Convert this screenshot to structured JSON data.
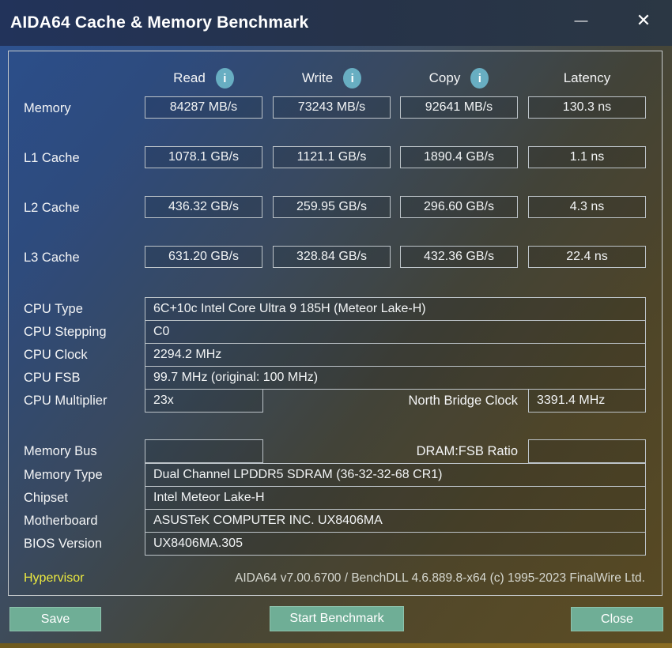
{
  "window": {
    "title": "AIDA64 Cache & Memory Benchmark",
    "minimize_glyph": "—",
    "close_glyph": "✕"
  },
  "benchmark": {
    "columns": [
      {
        "label": "Read",
        "has_info": true
      },
      {
        "label": "Write",
        "has_info": true
      },
      {
        "label": "Copy",
        "has_info": true
      },
      {
        "label": "Latency",
        "has_info": false
      }
    ],
    "info_glyph": "i",
    "rows": [
      {
        "label": "Memory",
        "values": [
          "84287 MB/s",
          "73243 MB/s",
          "92641 MB/s",
          "130.3 ns"
        ]
      },
      {
        "label": "L1 Cache",
        "values": [
          "1078.1 GB/s",
          "1121.1 GB/s",
          "1890.4 GB/s",
          "1.1 ns"
        ]
      },
      {
        "label": "L2 Cache",
        "values": [
          "436.32 GB/s",
          "259.95 GB/s",
          "296.60 GB/s",
          "4.3 ns"
        ]
      },
      {
        "label": "L3 Cache",
        "values": [
          "631.20 GB/s",
          "328.84 GB/s",
          "432.36 GB/s",
          "22.4 ns"
        ]
      }
    ]
  },
  "cpu_info": {
    "rows": [
      {
        "label": "CPU Type",
        "value": "6C+10c Intel Core Ultra 9 185H  (Meteor Lake-H)"
      },
      {
        "label": "CPU Stepping",
        "value": "C0"
      },
      {
        "label": "CPU Clock",
        "value": "2294.2 MHz"
      },
      {
        "label": "CPU FSB",
        "value": "99.7 MHz  (original: 100 MHz)"
      }
    ],
    "multiplier": {
      "label": "CPU Multiplier",
      "value": "23x"
    },
    "north_bridge": {
      "label": "North Bridge Clock",
      "value": "3391.4 MHz"
    }
  },
  "memory_info": {
    "bus": {
      "label": "Memory Bus",
      "value": ""
    },
    "dram_fsb": {
      "label": "DRAM:FSB Ratio",
      "value": ""
    },
    "rows": [
      {
        "label": "Memory Type",
        "value": "Dual Channel LPDDR5 SDRAM  (36-32-32-68 CR1)"
      },
      {
        "label": "Chipset",
        "value": "Intel Meteor Lake-H"
      },
      {
        "label": "Motherboard",
        "value": "ASUSTeK COMPUTER INC. UX8406MA"
      },
      {
        "label": "BIOS Version",
        "value": "UX8406MA.305"
      }
    ]
  },
  "footer": {
    "hypervisor_label": "Hypervisor",
    "version_text": "AIDA64 v7.00.6700 / BenchDLL 4.6.889.8-x64  (c) 1995-2023 FinalWire Ltd."
  },
  "buttons": {
    "save": "Save",
    "start": "Start Benchmark",
    "close": "Close"
  },
  "colors": {
    "button_accent": "#6fae96",
    "info_icon": "#68aec2",
    "hypervisor_text": "#ece93f",
    "titlebar": "#22335a"
  }
}
